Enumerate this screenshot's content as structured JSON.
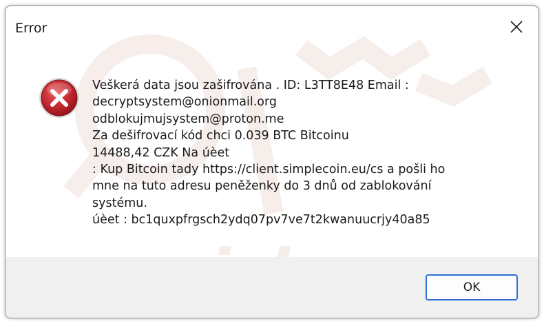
{
  "window": {
    "title": "Error",
    "close_icon": "close-icon"
  },
  "message": {
    "icon": "error-icon",
    "lines": [
      "Veškerá data jsou zašifrována . ID:   L3TT8E48  Email :",
      "decryptsystem@onionmail.org",
      "odblokujmujsystem@proton.me",
      "Za dešifrovací kód chci 0.039 BTC Bitcoinu",
      "14488,42 CZK Na úèet",
      ": Kup Bitcoin tady https://client.simplecoin.eu/cs a pošli ho",
      "mne na tuto adresu peněženky do 3 dnů od zablokování",
      "systému.",
      "úèet  : bc1quxpfrgsch2ydq07pv7ve7t2kwanuucrjy40a85"
    ]
  },
  "footer": {
    "ok_label": "OK"
  },
  "colors": {
    "accent": "#2f6fd6",
    "error_red": "#c0262e",
    "footer_bg": "#f0f0f0"
  }
}
